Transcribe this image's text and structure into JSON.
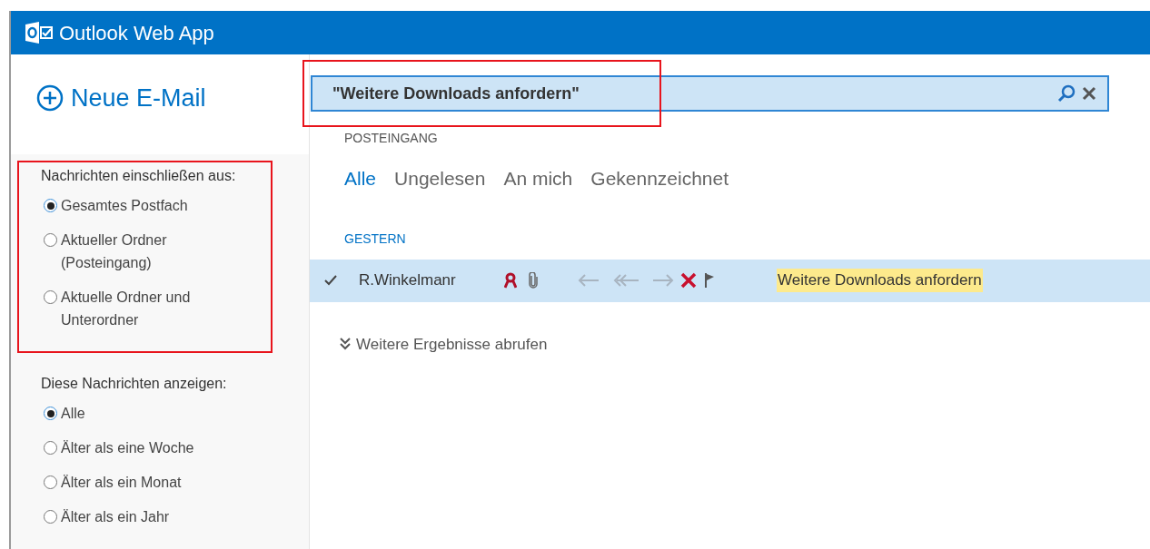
{
  "app": {
    "title": "Outlook Web App"
  },
  "new_mail": {
    "label": "Neue E-Mail"
  },
  "scope": {
    "heading": "Nachrichten einschließen aus:",
    "options": [
      {
        "lines": [
          "Gesamtes Postfach"
        ],
        "selected": true
      },
      {
        "lines": [
          "Aktueller Ordner",
          "(Posteingang)"
        ],
        "selected": false
      },
      {
        "lines": [
          "Aktuelle Ordner und",
          "Unterordner"
        ],
        "selected": false
      }
    ]
  },
  "show": {
    "heading": "Diese Nachrichten anzeigen:",
    "options": [
      {
        "lines": [
          "Alle"
        ],
        "selected": true
      },
      {
        "lines": [
          "Älter als eine Woche"
        ],
        "selected": false
      },
      {
        "lines": [
          "Älter als ein Monat"
        ],
        "selected": false
      },
      {
        "lines": [
          "Älter als ein Jahr"
        ],
        "selected": false
      }
    ]
  },
  "search": {
    "value": "\"Weitere Downloads anfordern\""
  },
  "folder": "POSTEINGANG",
  "filters": [
    {
      "label": "Alle",
      "selected": true
    },
    {
      "label": "Ungelesen",
      "selected": false
    },
    {
      "label": "An mich",
      "selected": false
    },
    {
      "label": "Gekennzeichnet",
      "selected": false
    }
  ],
  "group": "GESTERN",
  "messages": [
    {
      "sender": "R.Winkelmanr",
      "subject": "Weitere Downloads anfordern",
      "selected": true
    }
  ],
  "more": "Weitere Ergebnisse abrufen"
}
